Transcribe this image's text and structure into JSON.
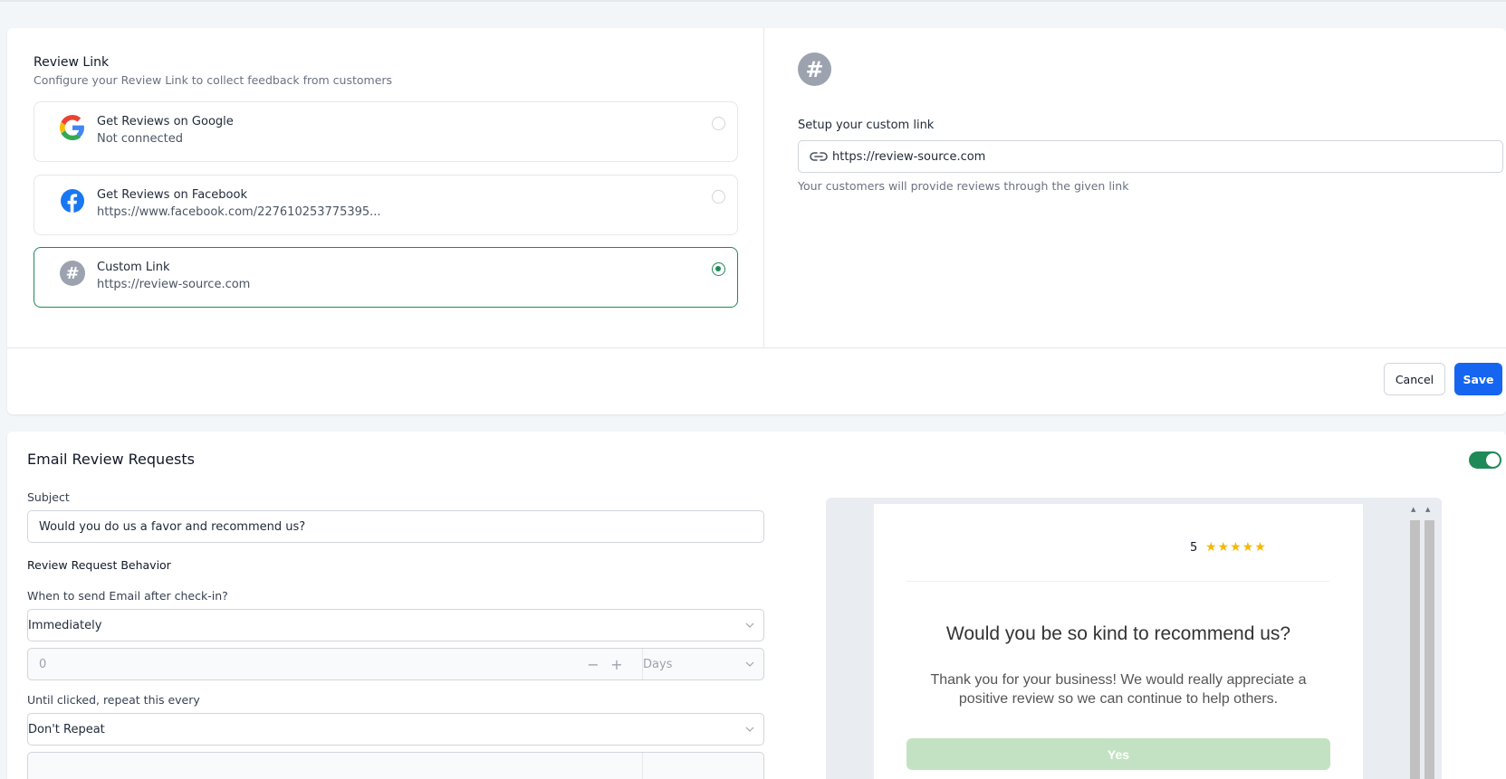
{
  "review_link": {
    "title": "Review Link",
    "subtitle": "Configure your Review Link to collect feedback from customers",
    "options": [
      {
        "title": "Get Reviews on Google",
        "detail": "Not connected",
        "icon": "google-icon",
        "selected": false
      },
      {
        "title": "Get Reviews on Facebook",
        "detail": "https://www.facebook.com/227610253775395...",
        "icon": "facebook-icon",
        "selected": false
      },
      {
        "title": "Custom Link",
        "detail": "https://review-source.com",
        "icon": "hash-icon",
        "selected": true
      }
    ],
    "hash_symbol": "#",
    "custom": {
      "label": "Setup your custom link",
      "value": "https://review-source.com",
      "help": "Your customers will provide reviews through the given link",
      "icon": "link-icon"
    },
    "cancel_label": "Cancel",
    "save_label": "Save"
  },
  "email_requests": {
    "title": "Email Review Requests",
    "enabled": true,
    "subject_label": "Subject",
    "subject_value": "Would you do us a favor and recommend us?",
    "behavior_label": "Review Request Behavior",
    "when_label": "When to send Email after check-in?",
    "when_value": "Immediately",
    "delay_value": "0",
    "delay_minus": "−",
    "delay_plus": "+",
    "delay_unit": "Days",
    "repeat_label": "Until clicked, repeat this every",
    "repeat_value": "Don't Repeat"
  },
  "preview": {
    "rating": "5",
    "stars": "★★★★★",
    "question": "Would you be so kind to recommend us?",
    "message": "Thank you for your business! We would really appreciate a positive review so we can continue to help others.",
    "yes_label": "Yes"
  },
  "colors": {
    "accent_green": "#1f8a57",
    "primary_blue": "#1565f0",
    "star_yellow": "#f5b70a"
  }
}
